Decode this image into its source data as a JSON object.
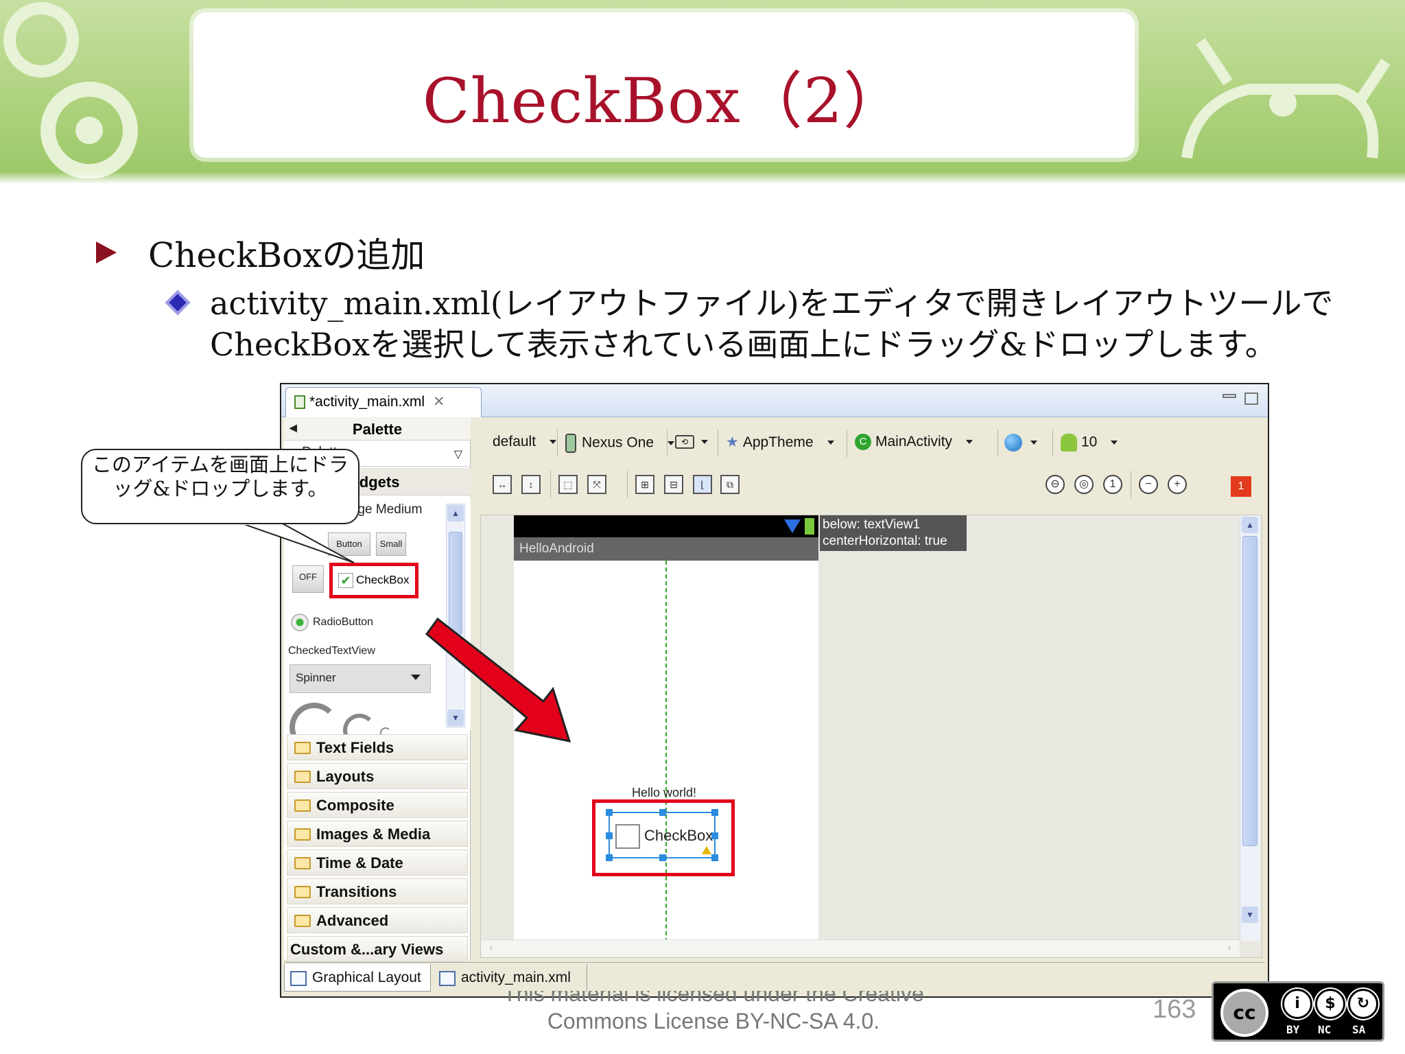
{
  "slide": {
    "title": "CheckBox（2）",
    "bullet1": "CheckBoxの追加",
    "bullet2": "activity_main.xml(レイアウトファイル)をエディタで開きレイアウトツールでCheckBoxを選択して表示されている画面上にドラッグ&ドロップします。",
    "callout": "このアイテムを画面上にドラッグ&ドロップします。",
    "page_number": "163",
    "license_line1": "This material is licensed under the Creative",
    "license_line2": "Commons License BY-NC-SA 4.0.",
    "cc_labels": [
      "BY",
      "NC",
      "SA"
    ],
    "cc_badge": "cc",
    "colors": {
      "title": "#a8112a",
      "highlight": "#e3001b",
      "banner": "#aed27e"
    }
  },
  "eclipse": {
    "editor_tab": "*activity_main.xml",
    "palette": {
      "title": "Palette",
      "dropdown": "Palette",
      "group": "Form Widgets",
      "widgets": {
        "large_text": "Large Medium",
        "button": "Button",
        "small": "Small",
        "toggle": "OFF",
        "checkbox": "CheckBox",
        "radio": "RadioButton",
        "checked_text_view": "CheckedTextView",
        "spinner": "Spinner"
      },
      "categories": [
        "Text Fields",
        "Layouts",
        "Composite",
        "Images & Media",
        "Time & Date",
        "Transitions",
        "Advanced",
        "Custom &...ary Views"
      ]
    },
    "toolbar": {
      "config": "default",
      "device": "Nexus One",
      "theme": "AppTheme",
      "activity": "MainActivity",
      "api": "10",
      "error_count": "1"
    },
    "canvas": {
      "app_title": "HelloAndroid",
      "hello_text": "Hello world!",
      "checkbox_text": "CheckBox",
      "tooltip_line1": "below: textView1",
      "tooltip_line2": "centerHorizontal: true"
    },
    "bottom_tabs": [
      "Graphical Layout",
      "activity_main.xml"
    ]
  }
}
